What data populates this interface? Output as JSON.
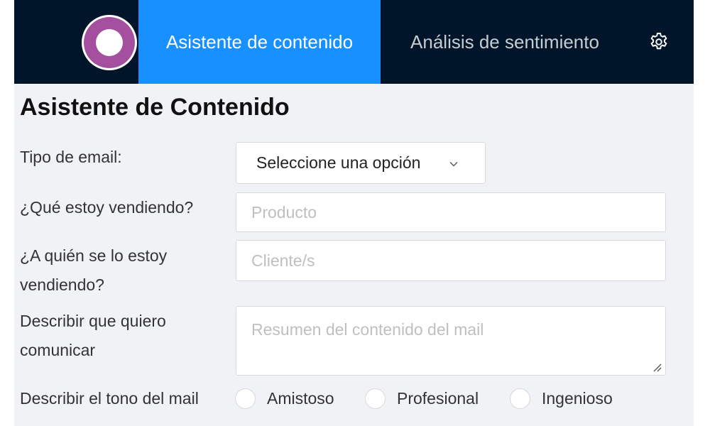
{
  "nav": {
    "tabs": [
      {
        "label": "Asistente de contenido",
        "active": true
      },
      {
        "label": "Análisis de sentimiento",
        "active": false
      }
    ],
    "settings_icon": "gear-icon",
    "logo_icon": "ring-logo"
  },
  "page": {
    "title": "Asistente de Contenido"
  },
  "form": {
    "email_type": {
      "label": "Tipo de email:",
      "selected": "Seleccione una opción"
    },
    "product": {
      "label": "¿Qué estoy vendiendo?",
      "placeholder": "Producto",
      "value": ""
    },
    "customer": {
      "label_line1": "¿A quién se lo estoy",
      "label_line2": "vendiendo?",
      "placeholder": "Cliente/s",
      "value": ""
    },
    "summary": {
      "label_line1": "Describir que quiero",
      "label_line2": "comunicar",
      "placeholder": "Resumen del contenido del mail",
      "value": ""
    },
    "tone": {
      "label": "Describir el tono del mail",
      "options": [
        "Amistoso",
        "Profesional",
        "Ingenioso"
      ],
      "selected": null
    }
  },
  "colors": {
    "navbar": "#001529",
    "active_tab": "#1890ff",
    "logo": "#a4509e",
    "background": "#f0f2f5"
  }
}
